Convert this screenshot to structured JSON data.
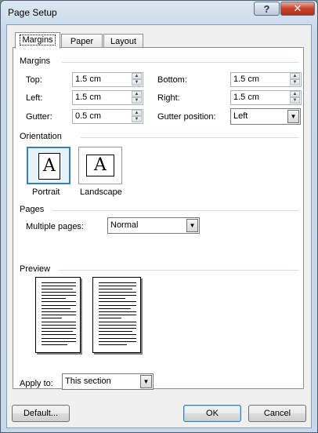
{
  "window": {
    "title": "Page Setup",
    "help_icon": "?",
    "close_icon": "✕"
  },
  "tabs": [
    {
      "label": "Margins",
      "active": true
    },
    {
      "label": "Paper",
      "active": false
    },
    {
      "label": "Layout",
      "active": false
    }
  ],
  "margins": {
    "group": "Margins",
    "top": {
      "label": "Top:",
      "value": "1.5 cm"
    },
    "left": {
      "label": "Left:",
      "value": "1.5 cm"
    },
    "gutter": {
      "label": "Gutter:",
      "value": "0.5 cm"
    },
    "bottom": {
      "label": "Bottom:",
      "value": "1.5 cm"
    },
    "right": {
      "label": "Right:",
      "value": "1.5 cm"
    },
    "gutter_position": {
      "label": "Gutter position:",
      "value": "Left"
    }
  },
  "orientation": {
    "group": "Orientation",
    "icon_glyph": "A",
    "portrait": "Portrait",
    "landscape": "Landscape",
    "selected": "Portrait"
  },
  "pages": {
    "group": "Pages",
    "multiple_label": "Multiple pages:",
    "multiple_value": "Normal"
  },
  "preview": {
    "group": "Preview"
  },
  "apply": {
    "label": "Apply to:",
    "value": "This section"
  },
  "buttons": {
    "default": "Default...",
    "ok": "OK",
    "cancel": "Cancel"
  }
}
